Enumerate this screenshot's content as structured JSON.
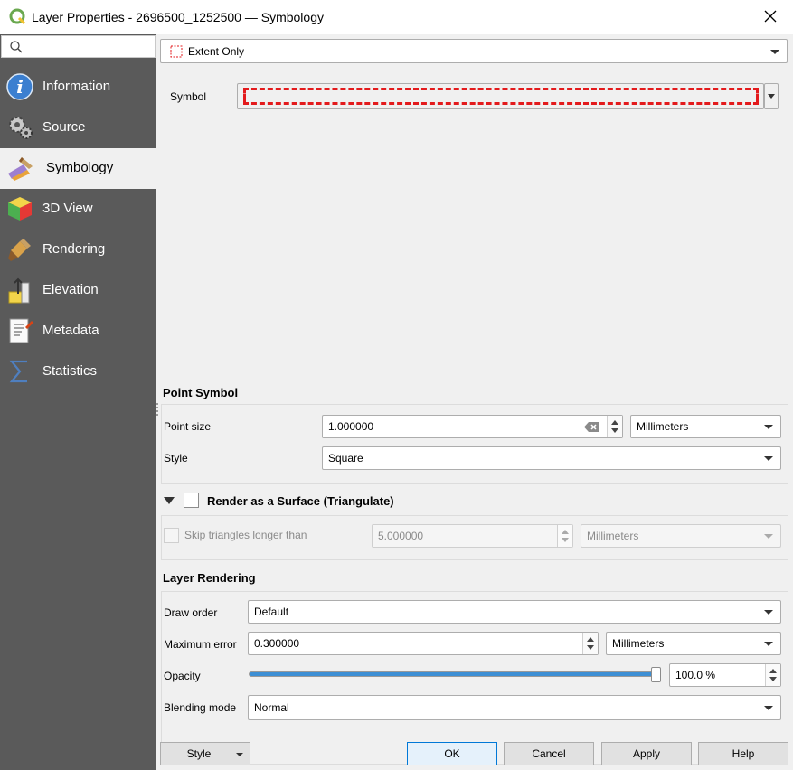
{
  "window": {
    "title": "Layer Properties - 2696500_1252500 — Symbology"
  },
  "sidebar": {
    "search_placeholder": "",
    "items": [
      {
        "label": "Information",
        "icon": "information-icon"
      },
      {
        "label": "Source",
        "icon": "source-icon"
      },
      {
        "label": "Symbology",
        "icon": "symbology-icon",
        "active": true
      },
      {
        "label": "3D View",
        "icon": "3d-view-icon"
      },
      {
        "label": "Rendering",
        "icon": "rendering-icon"
      },
      {
        "label": "Elevation",
        "icon": "elevation-icon"
      },
      {
        "label": "Metadata",
        "icon": "metadata-icon"
      },
      {
        "label": "Statistics",
        "icon": "statistics-icon"
      }
    ]
  },
  "renderer": {
    "selected": "Extent Only",
    "symbol_label": "Symbol",
    "symbol_color": "#e31a1c"
  },
  "point_symbol": {
    "heading": "Point Symbol",
    "size_label": "Point size",
    "size_value": "1.000000",
    "size_unit": "Millimeters",
    "style_label": "Style",
    "style_value": "Square"
  },
  "surface": {
    "heading": "Render as a Surface (Triangulate)",
    "checked": false,
    "skip_label": "Skip triangles longer than",
    "skip_value": "5.000000",
    "skip_unit": "Millimeters"
  },
  "layer_rendering": {
    "heading": "Layer Rendering",
    "draw_order_label": "Draw order",
    "draw_order_value": "Default",
    "max_error_label": "Maximum error",
    "max_error_value": "0.300000",
    "max_error_unit": "Millimeters",
    "opacity_label": "Opacity",
    "opacity_value": "100.0 %",
    "opacity_fraction": 1.0,
    "blending_label": "Blending mode",
    "blending_value": "Normal"
  },
  "footer": {
    "style": "Style",
    "ok": "OK",
    "cancel": "Cancel",
    "apply": "Apply",
    "help": "Help"
  },
  "colors": {
    "sidebar_bg": "#5a5a5a",
    "slider_fill": "#3d8fd4",
    "accent": "#0078d7"
  }
}
